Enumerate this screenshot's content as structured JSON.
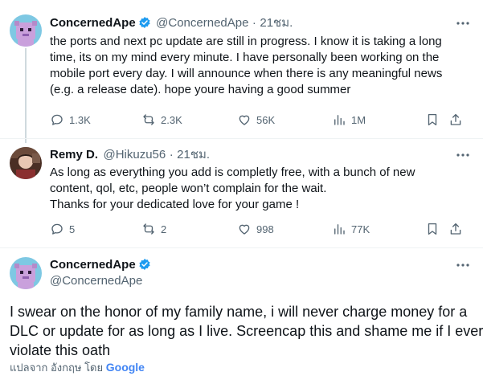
{
  "tweet1": {
    "name": "ConcernedApe",
    "handle": "@ConcernedApe",
    "dot": "·",
    "time": "21ชม.",
    "lines": [
      "the ports and next pc update are still in progress. I know it is taking a long",
      "time, its on my mind every minute. I have personally been working on the",
      "mobile port every day. I will announce when there is any meaningful news",
      "(e.g. a release date). hope youre having a good summer"
    ],
    "replies": "1.3K",
    "retweets": "2.3K",
    "likes": "56K",
    "views": "1M"
  },
  "tweet2": {
    "name": "Remy D.",
    "handle": "@Hikuzu56",
    "dot": "·",
    "time": "21ชม.",
    "lines": [
      "As long as everything you add is completly free, with a bunch of new",
      "content, qol, etc, people won’t complain for the wait.",
      "Thanks for your dedicated love for your game !"
    ],
    "replies": "5",
    "retweets": "2",
    "likes": "998",
    "views": "77K"
  },
  "tweet3": {
    "name": "ConcernedApe",
    "handle": "@ConcernedApe",
    "lines": [
      "I swear on the honor of my family name,  i will never charge money for a",
      "DLC or update for as long as I live. Screencap this and shame me if I ever",
      "violate this oath"
    ],
    "translate_label": "แปลจาก อังกฤษ โดย",
    "google": "Google"
  },
  "colors": {
    "verified": "#1d9bf0",
    "muted": "#536471",
    "divider": "#eff3f4"
  }
}
